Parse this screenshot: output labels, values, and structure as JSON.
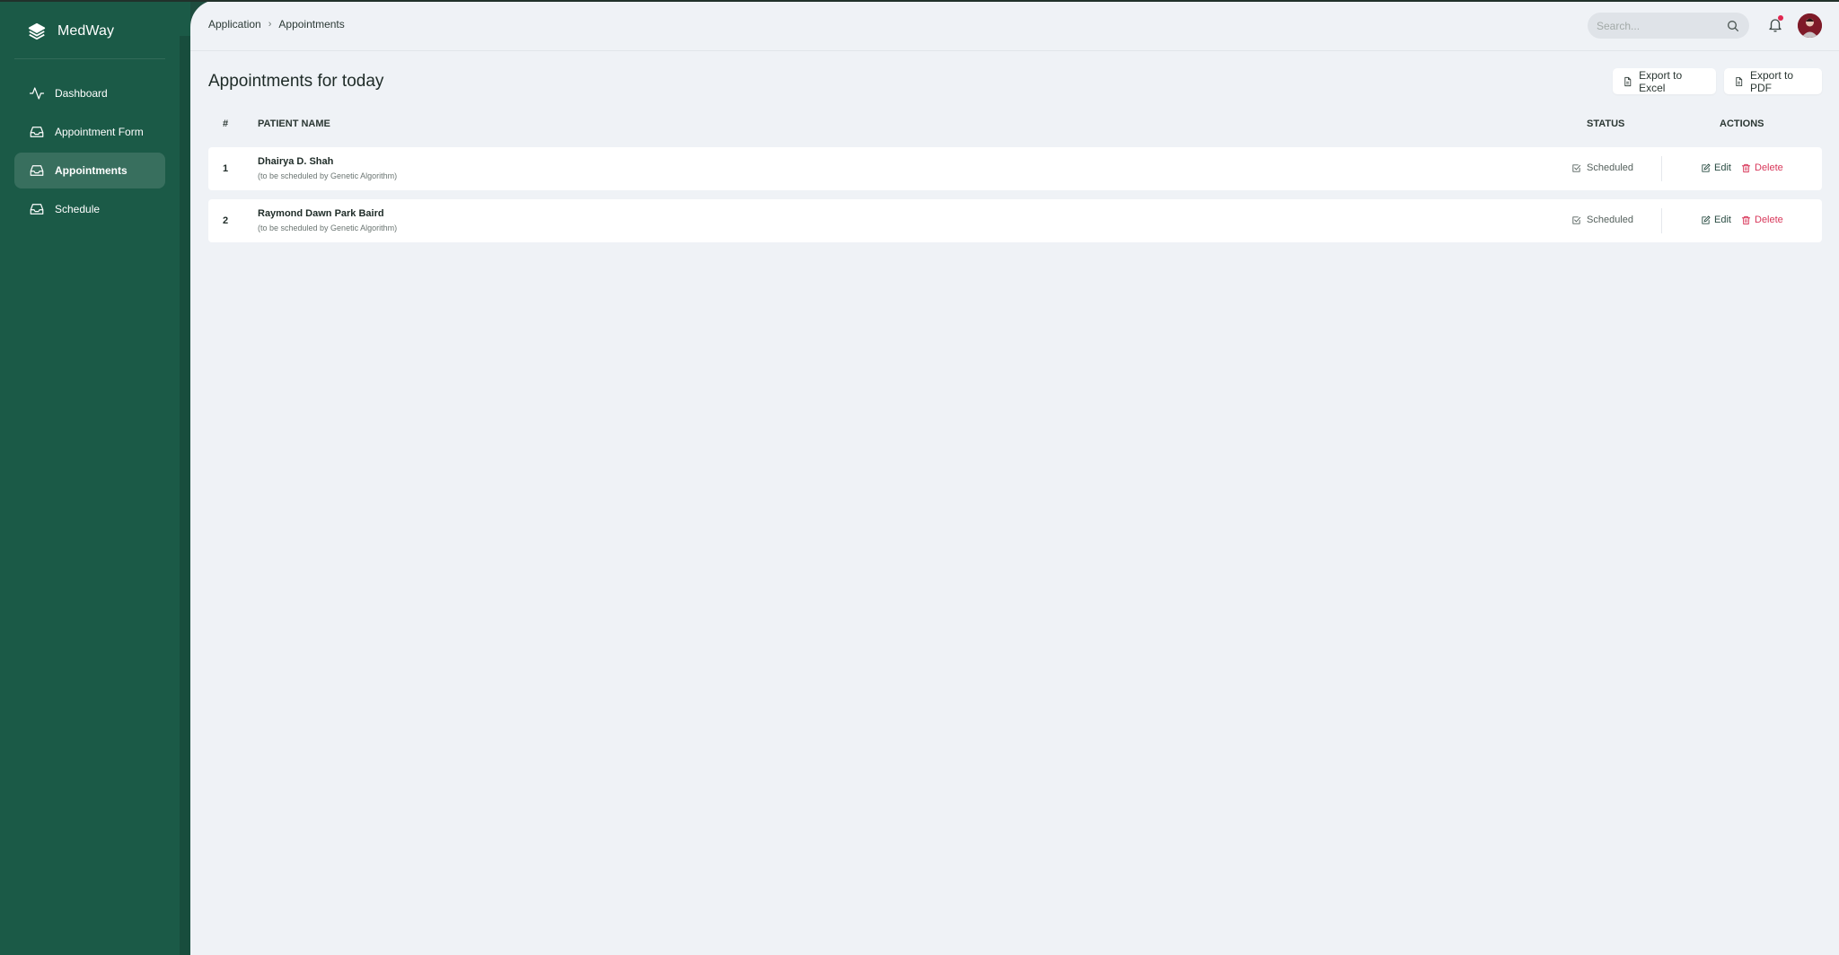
{
  "app": {
    "brand": "MedWay"
  },
  "sidebar": {
    "items": [
      {
        "label": "Dashboard",
        "icon": "activity-icon",
        "active": false
      },
      {
        "label": "Appointment Form",
        "icon": "inbox-icon",
        "active": false
      },
      {
        "label": "Appointments",
        "icon": "inbox-icon",
        "active": true
      },
      {
        "label": "Schedule",
        "icon": "inbox-icon",
        "active": false
      }
    ]
  },
  "header": {
    "breadcrumb": [
      "Application",
      "Appointments"
    ],
    "search_placeholder": "Search...",
    "notification_dot_color": "#e0264f"
  },
  "page": {
    "title": "Appointments for today",
    "export_excel": "Export to Excel",
    "export_pdf": "Export to PDF"
  },
  "table": {
    "headers": {
      "num": "#",
      "name": "PATIENT NAME",
      "status": "STATUS",
      "actions": "ACTIONS"
    },
    "rows": [
      {
        "num": "1",
        "name": "Dhairya D. Shah",
        "note": "(to be scheduled by Genetic Algorithm)",
        "status": "Scheduled",
        "edit": "Edit",
        "delete": "Delete"
      },
      {
        "num": "2",
        "name": "Raymond Dawn Park Baird",
        "note": "(to be scheduled by Genetic Algorithm)",
        "status": "Scheduled",
        "edit": "Edit",
        "delete": "Delete"
      }
    ]
  },
  "colors": {
    "sidebar": "#1b5a47",
    "accent_delete": "#d8375a",
    "background": "#eff2f6"
  }
}
